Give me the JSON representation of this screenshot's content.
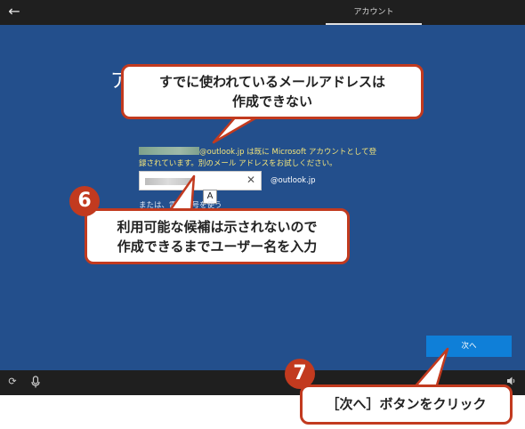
{
  "header": {
    "back_icon": "back-arrow-icon",
    "tab_label": "アカウント"
  },
  "main": {
    "heading_fragment": "ア",
    "error_message": {
      "domain": "@outlook.jp",
      "text_line1": " は既に Microsoft アカウントとして登",
      "text_line2": "録されています。別のメール アドレスをお試しください。"
    },
    "email_input": {
      "value_redacted": true,
      "clear_icon": "clear-x-icon"
    },
    "ime_indicator": "A",
    "domain_suffix": "@outlook.jp",
    "alt_link": "または、電話番号を使う",
    "next_button": "次へ"
  },
  "bottombar": {
    "icons": [
      "ease-of-access-icon",
      "microphone-icon",
      "volume-icon"
    ]
  },
  "annotations": {
    "callout1": {
      "line1": "すでに使われているメールアドレスは",
      "line2": "作成できない"
    },
    "badge6": "6",
    "callout2": {
      "line1": "利用可能な候補は示されないので",
      "line2": "作成できるまでユーザー名を入力"
    },
    "badge7": "7",
    "callout3": "［次へ］ボタンをクリック"
  },
  "colors": {
    "background": "#234f8c",
    "error_text": "#f3e57a",
    "next_button": "#0f7fd8",
    "annotation_red": "#c23a1f"
  }
}
